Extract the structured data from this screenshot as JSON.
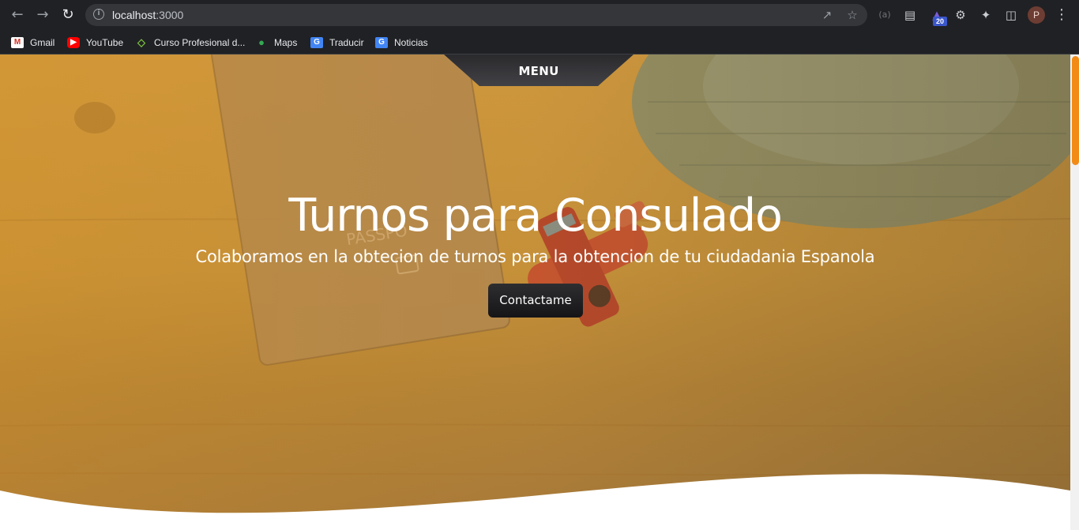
{
  "browser": {
    "url_host": "localhost",
    "url_port": ":3000",
    "profile_initial": "P",
    "extension_badge": "20",
    "icons": {
      "back": "arrow-left-icon",
      "forward": "arrow-right-icon",
      "reload": "reload-icon",
      "info": "info-icon",
      "share": "share-icon",
      "bookmark": "star-icon",
      "extensions": "puzzle-icon",
      "side_panel": "side-panel-icon",
      "menu": "kebab-menu-icon"
    }
  },
  "bookmarks": [
    {
      "label": "Gmail",
      "icon": "gmail-icon",
      "color": "#d93025"
    },
    {
      "label": "YouTube",
      "icon": "youtube-icon",
      "color": "#ff0000"
    },
    {
      "label": "Curso Profesional d...",
      "icon": "course-icon",
      "color": "#7cc242"
    },
    {
      "label": "Maps",
      "icon": "maps-icon",
      "color": "#34a853"
    },
    {
      "label": "Traducir",
      "icon": "translate-icon",
      "color": "#4285f4"
    },
    {
      "label": "Noticias",
      "icon": "news-icon",
      "color": "#4285f4"
    }
  ],
  "page": {
    "menu_label": "MENU",
    "hero_title": "Turnos para Consulado",
    "hero_subtitle": "Colaboramos en la obtecion de turnos para la obtencion de tu ciudadania Espanola",
    "cta_label": "Contactame",
    "accent_color": "#f28b16"
  }
}
